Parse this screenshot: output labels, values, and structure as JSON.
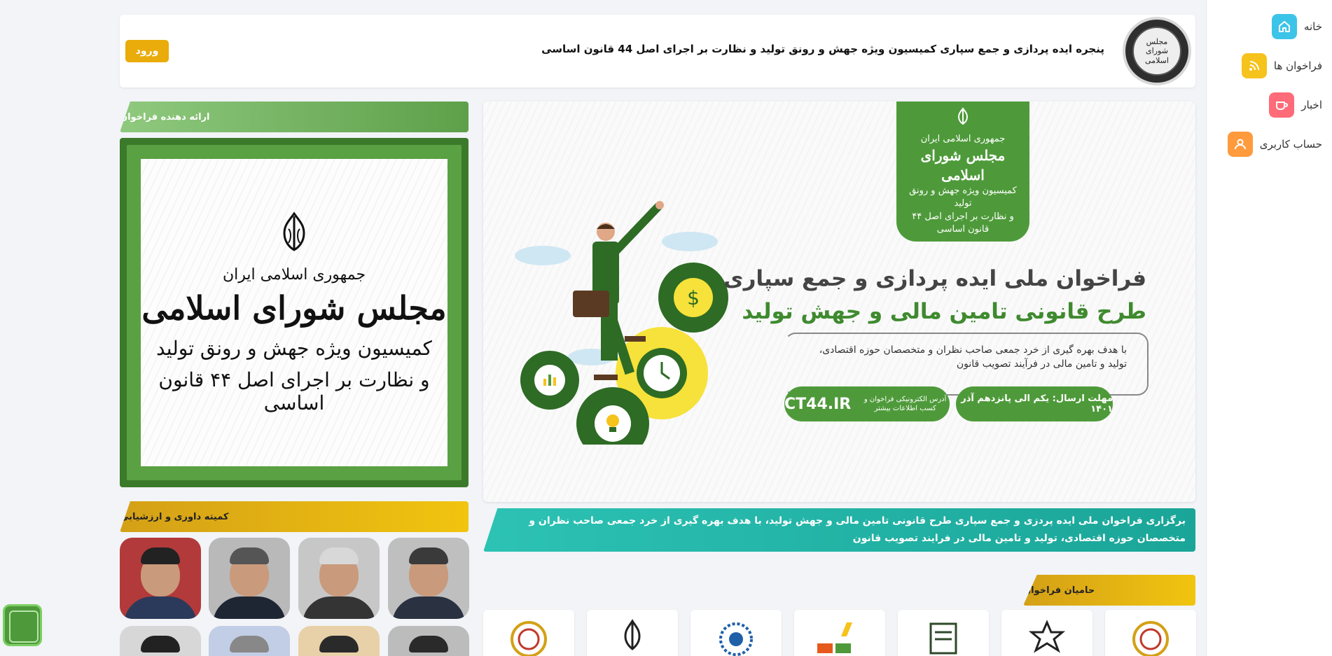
{
  "header": {
    "title": "پنجره ایده پردازی و جمع سپاری کمیسیون ویژه جهش و رونق تولید و نظارت بر اجرای اصل 44 قانون اساسی",
    "login_label": "ورود",
    "logo_text": "مجلس شورای اسلامی"
  },
  "nav": [
    {
      "label": "خانه",
      "icon": "home-icon",
      "color": "#3cc4e8"
    },
    {
      "label": "فراخوان ها",
      "icon": "rss-icon",
      "color": "#f6c21c"
    },
    {
      "label": "اخبار",
      "icon": "cup-icon",
      "color": "#ff6b78"
    },
    {
      "label": "حساب کاربری",
      "icon": "user-icon",
      "color": "#ff9a3d"
    }
  ],
  "banner": {
    "badge_line1": "جمهوری اسلامی ایران",
    "badge_line2": "مجلس شورای اسلامی",
    "badge_line3": "کمیسیون ویژه جهش و رونق تولید",
    "badge_line4": "و نظارت بر اجرای اصل ۴۴ قانون اساسی",
    "title_line1": "فراخوان ملی ایده پردازی و جمع سپاری",
    "title_line2": "طرح قانونی تامین مالی و جهش تولید",
    "description": "با هدف بهره گیری از خرد جمعی صاحب نظران و متخصصان حوزه اقتصادی، تولید و تامین مالی در فرآیند تصویب قانون",
    "deadline": "مهلت ارسال: یکم الی پانزدهم آذر ۱۴۰۱",
    "site_label": "آدرس الکترونیکی فراخوان و کسب اطلاعات بیشتر",
    "site_url": "CT44.IR"
  },
  "description_strip": "برگزاری فراخوان ملی ایده پردزی و جمع سپاری طرح قانونی تامین مالی و جهش تولید، با هدف بهره گیری از خرد جمعی صاحب نظران و متخصصان حوزه اقتصادی، تولید و تامین مالی در فرایند تصویب قانون",
  "sections": {
    "provider": "ارائه دهنده فراخوان",
    "committee": "کمیته داوری و ارزشیابی",
    "sponsors": "حامیان فراخوان"
  },
  "provider_logo": {
    "line1": "جمهوری اسلامی ایران",
    "line2": "مجلس شورای اسلامی",
    "line3": "کمیسیون ویژه جهش و رونق تولید",
    "line4": "و نظارت بر اجرای اصل ۴۴ قانون اساسی"
  }
}
